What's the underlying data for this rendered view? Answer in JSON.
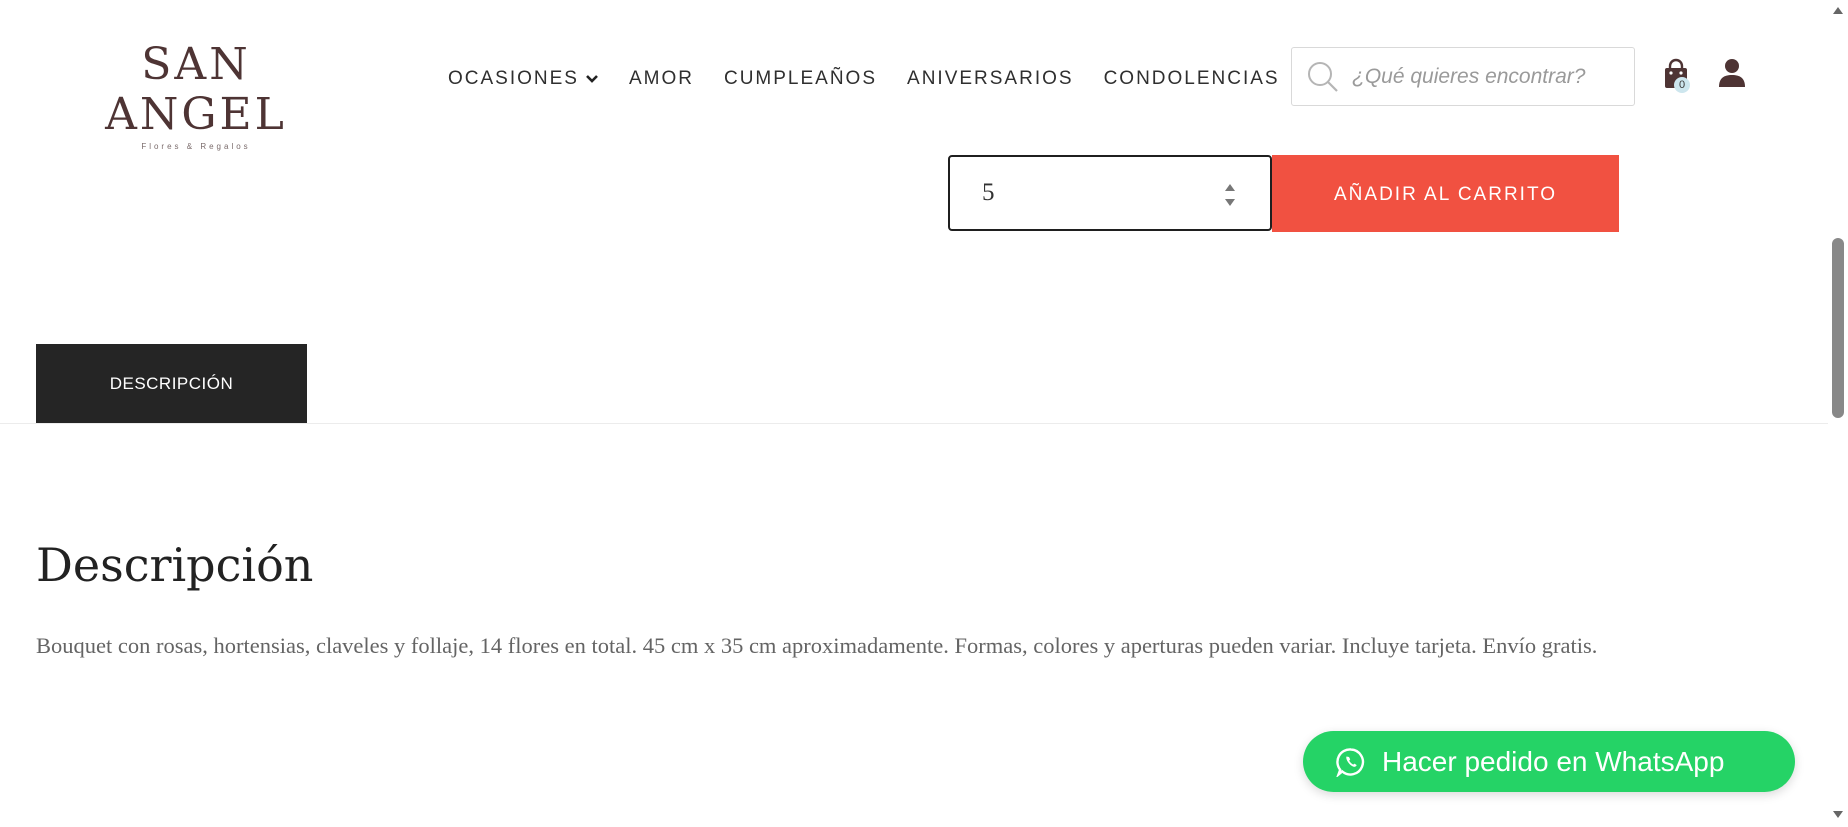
{
  "header": {
    "logo": {
      "main": "SAN ANGEL",
      "sub": "Flores & Regalos"
    },
    "nav": [
      {
        "label": "OCASIONES",
        "has_dropdown": true
      },
      {
        "label": "AMOR"
      },
      {
        "label": "CUMPLEAÑOS"
      },
      {
        "label": "ANIVERSARIOS"
      },
      {
        "label": "CONDOLENCIAS"
      }
    ],
    "search": {
      "placeholder": "¿Qué quieres encontrar?",
      "icon": "search-icon"
    },
    "cart": {
      "icon": "shopping-bag-icon",
      "count": "0"
    },
    "account": {
      "icon": "user-icon"
    }
  },
  "product": {
    "quantity_value": "5",
    "add_to_cart_label": "AÑADIR AL CARRITO"
  },
  "tabs": [
    {
      "label": "DESCRIPCIÓN",
      "active": true
    }
  ],
  "description": {
    "title": "Descripción",
    "text": "Bouquet con rosas, hortensias, claveles y follaje, 14 flores en total. 45  cm x 35 cm aproximadamente. Formas, colores y aperturas pueden variar. Incluye tarjeta. Envío gratis."
  },
  "whatsapp": {
    "label": "Hacer pedido en WhatsApp",
    "icon": "whatsapp-icon"
  },
  "colors": {
    "accent": "#f15141",
    "whatsapp": "#25d366",
    "tab_active": "#252525",
    "logo": "#4e3434"
  }
}
